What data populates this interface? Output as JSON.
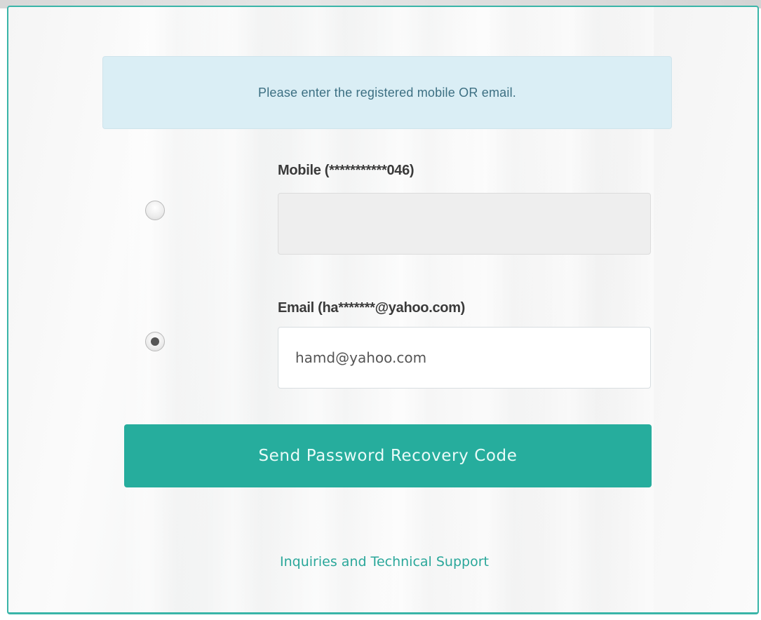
{
  "notice": {
    "text": "Please enter the registered mobile OR email."
  },
  "form": {
    "mobile": {
      "label": "Mobile (***********046)",
      "value": "",
      "selected": false
    },
    "email": {
      "label": "Email (ha*******@yahoo.com)",
      "value": "hamd@yahoo.com",
      "selected": true
    },
    "submit_label": "Send Password Recovery Code"
  },
  "footer": {
    "support_link": "Inquiries and Technical Support"
  },
  "colors": {
    "accent": "#26ad9d",
    "card_border": "#39b5a8",
    "notice_bg": "#daeef5",
    "notice_text": "#3c6f82",
    "link": "#2aa79a"
  }
}
